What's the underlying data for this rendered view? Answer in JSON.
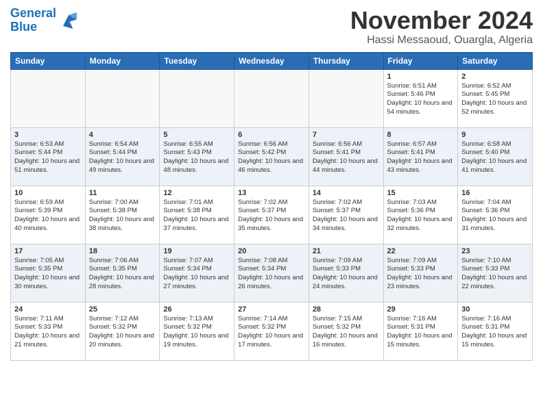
{
  "header": {
    "logo_line1": "General",
    "logo_line2": "Blue",
    "month": "November 2024",
    "location": "Hassi Messaoud, Ouargla, Algeria"
  },
  "days_of_week": [
    "Sunday",
    "Monday",
    "Tuesday",
    "Wednesday",
    "Thursday",
    "Friday",
    "Saturday"
  ],
  "weeks": [
    [
      {
        "day": "",
        "empty": true
      },
      {
        "day": "",
        "empty": true
      },
      {
        "day": "",
        "empty": true
      },
      {
        "day": "",
        "empty": true
      },
      {
        "day": "",
        "empty": true
      },
      {
        "day": "1",
        "rise": "6:51 AM",
        "set": "5:46 PM",
        "hours": "10 hours and 54 minutes"
      },
      {
        "day": "2",
        "rise": "6:52 AM",
        "set": "5:45 PM",
        "hours": "10 hours and 52 minutes"
      }
    ],
    [
      {
        "day": "3",
        "rise": "6:53 AM",
        "set": "5:44 PM",
        "hours": "10 hours and 51 minutes"
      },
      {
        "day": "4",
        "rise": "6:54 AM",
        "set": "5:44 PM",
        "hours": "10 hours and 49 minutes"
      },
      {
        "day": "5",
        "rise": "6:55 AM",
        "set": "5:43 PM",
        "hours": "10 hours and 48 minutes"
      },
      {
        "day": "6",
        "rise": "6:56 AM",
        "set": "5:42 PM",
        "hours": "10 hours and 46 minutes"
      },
      {
        "day": "7",
        "rise": "6:56 AM",
        "set": "5:41 PM",
        "hours": "10 hours and 44 minutes"
      },
      {
        "day": "8",
        "rise": "6:57 AM",
        "set": "5:41 PM",
        "hours": "10 hours and 43 minutes"
      },
      {
        "day": "9",
        "rise": "6:58 AM",
        "set": "5:40 PM",
        "hours": "10 hours and 41 minutes"
      }
    ],
    [
      {
        "day": "10",
        "rise": "6:59 AM",
        "set": "5:39 PM",
        "hours": "10 hours and 40 minutes"
      },
      {
        "day": "11",
        "rise": "7:00 AM",
        "set": "5:38 PM",
        "hours": "10 hours and 38 minutes"
      },
      {
        "day": "12",
        "rise": "7:01 AM",
        "set": "5:38 PM",
        "hours": "10 hours and 37 minutes"
      },
      {
        "day": "13",
        "rise": "7:02 AM",
        "set": "5:37 PM",
        "hours": "10 hours and 35 minutes"
      },
      {
        "day": "14",
        "rise": "7:02 AM",
        "set": "5:37 PM",
        "hours": "10 hours and 34 minutes"
      },
      {
        "day": "15",
        "rise": "7:03 AM",
        "set": "5:36 PM",
        "hours": "10 hours and 32 minutes"
      },
      {
        "day": "16",
        "rise": "7:04 AM",
        "set": "5:36 PM",
        "hours": "10 hours and 31 minutes"
      }
    ],
    [
      {
        "day": "17",
        "rise": "7:05 AM",
        "set": "5:35 PM",
        "hours": "10 hours and 30 minutes"
      },
      {
        "day": "18",
        "rise": "7:06 AM",
        "set": "5:35 PM",
        "hours": "10 hours and 28 minutes"
      },
      {
        "day": "19",
        "rise": "7:07 AM",
        "set": "5:34 PM",
        "hours": "10 hours and 27 minutes"
      },
      {
        "day": "20",
        "rise": "7:08 AM",
        "set": "5:34 PM",
        "hours": "10 hours and 26 minutes"
      },
      {
        "day": "21",
        "rise": "7:09 AM",
        "set": "5:33 PM",
        "hours": "10 hours and 24 minutes"
      },
      {
        "day": "22",
        "rise": "7:09 AM",
        "set": "5:33 PM",
        "hours": "10 hours and 23 minutes"
      },
      {
        "day": "23",
        "rise": "7:10 AM",
        "set": "5:33 PM",
        "hours": "10 hours and 22 minutes"
      }
    ],
    [
      {
        "day": "24",
        "rise": "7:11 AM",
        "set": "5:33 PM",
        "hours": "10 hours and 21 minutes"
      },
      {
        "day": "25",
        "rise": "7:12 AM",
        "set": "5:32 PM",
        "hours": "10 hours and 20 minutes"
      },
      {
        "day": "26",
        "rise": "7:13 AM",
        "set": "5:32 PM",
        "hours": "10 hours and 19 minutes"
      },
      {
        "day": "27",
        "rise": "7:14 AM",
        "set": "5:32 PM",
        "hours": "10 hours and 17 minutes"
      },
      {
        "day": "28",
        "rise": "7:15 AM",
        "set": "5:32 PM",
        "hours": "10 hours and 16 minutes"
      },
      {
        "day": "29",
        "rise": "7:16 AM",
        "set": "5:31 PM",
        "hours": "10 hours and 15 minutes"
      },
      {
        "day": "30",
        "rise": "7:16 AM",
        "set": "5:31 PM",
        "hours": "10 hours and 15 minutes"
      }
    ]
  ]
}
